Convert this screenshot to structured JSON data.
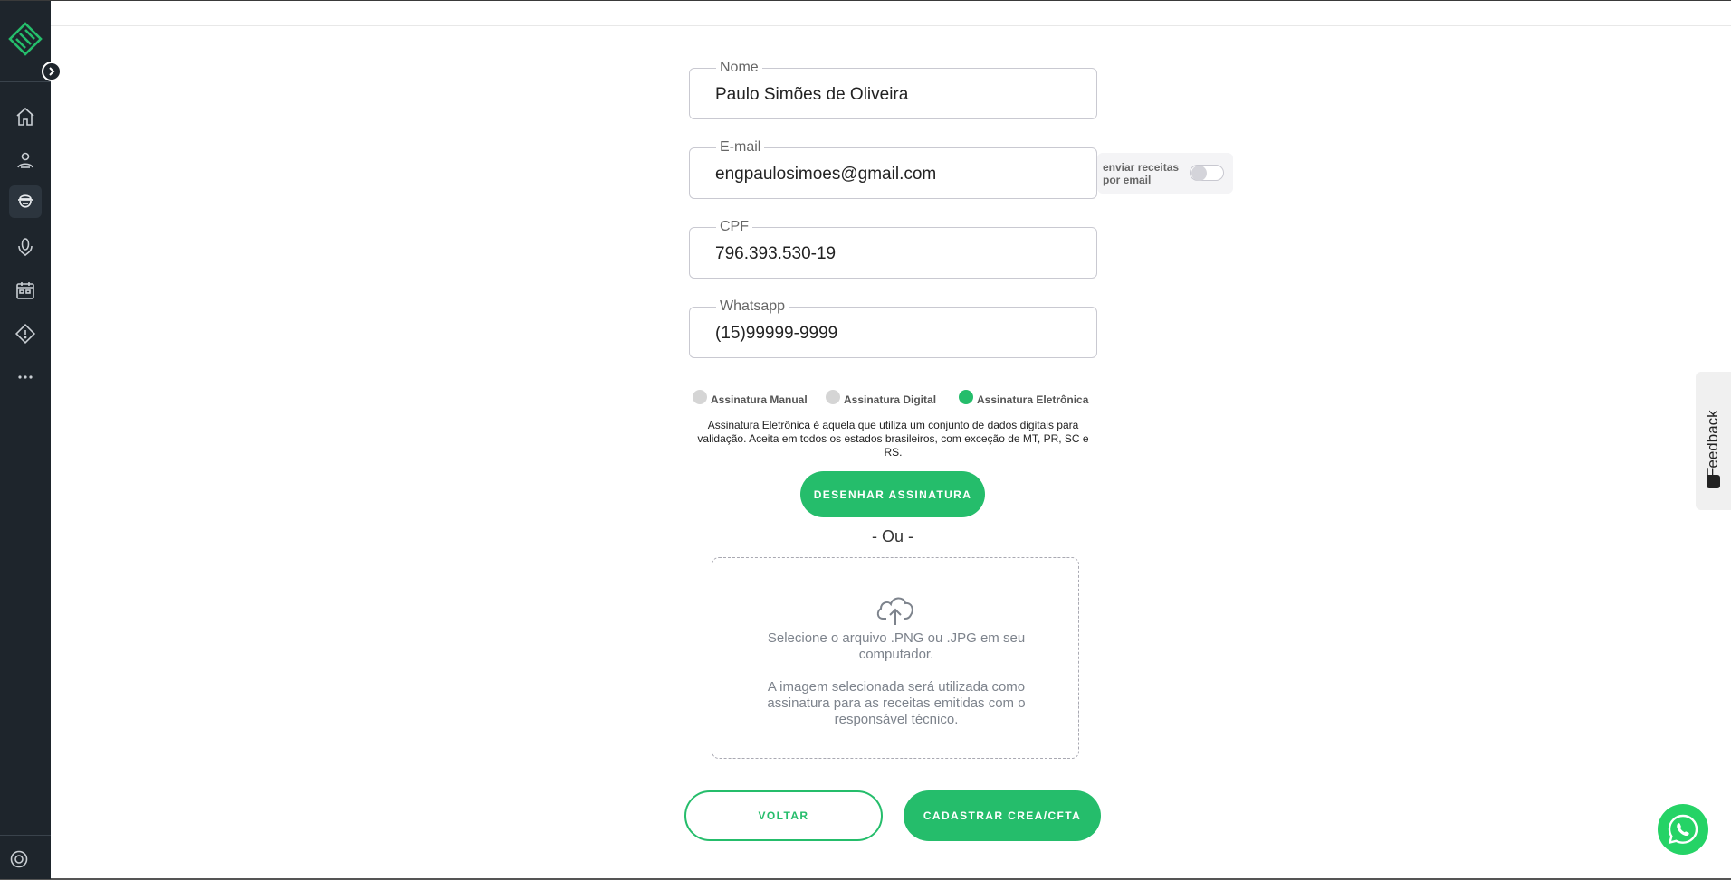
{
  "form": {
    "name": {
      "label": "Nome",
      "value": "Paulo Simões de Oliveira"
    },
    "email": {
      "label": "E-mail",
      "value": "engpaulosimoes@gmail.com"
    },
    "cpf": {
      "label": "CPF",
      "value": "796.393.530-19"
    },
    "whatsapp": {
      "label": "Whatsapp",
      "value": "(15)99999-9999"
    },
    "email_toggle": {
      "label": "enviar receitas por email",
      "on": false
    }
  },
  "signature": {
    "options": [
      {
        "label": "Assinatura Manual",
        "selected": false
      },
      {
        "label": "Assinatura Digital",
        "selected": false
      },
      {
        "label": "Assinatura Eletrônica",
        "selected": true
      }
    ],
    "description": "Assinatura Eletrônica é aquela que utiliza um conjunto de dados digitais para validação. Aceita em todos os estados brasileiros, com exceção de MT, PR, SC e RS.",
    "draw_button": "DESENHAR ASSINATURA",
    "or_text": "- Ou -",
    "upload_text": "Selecione o arquivo .PNG ou .JPG em seu computador.",
    "upload_note": "A imagem selecionada será utilizada como assinatura para as receitas emitidas com o responsável técnico."
  },
  "actions": {
    "back": "VOLTAR",
    "submit": "CADASTRAR CREA/CFTA"
  },
  "feedback": {
    "label": "Feedback"
  },
  "colors": {
    "accent": "#25bd6b",
    "sidebar": "#1e252c",
    "whatsapp": "#25d366"
  },
  "sidebar": {
    "items": [
      {
        "icon": "home-icon"
      },
      {
        "icon": "farmer-icon"
      },
      {
        "icon": "agronomist-icon",
        "active": true
      },
      {
        "icon": "corn-icon"
      },
      {
        "icon": "calendar-icon"
      },
      {
        "icon": "alert-icon"
      },
      {
        "icon": "more-icon"
      }
    ],
    "bottom_icon": "settings-icon"
  }
}
